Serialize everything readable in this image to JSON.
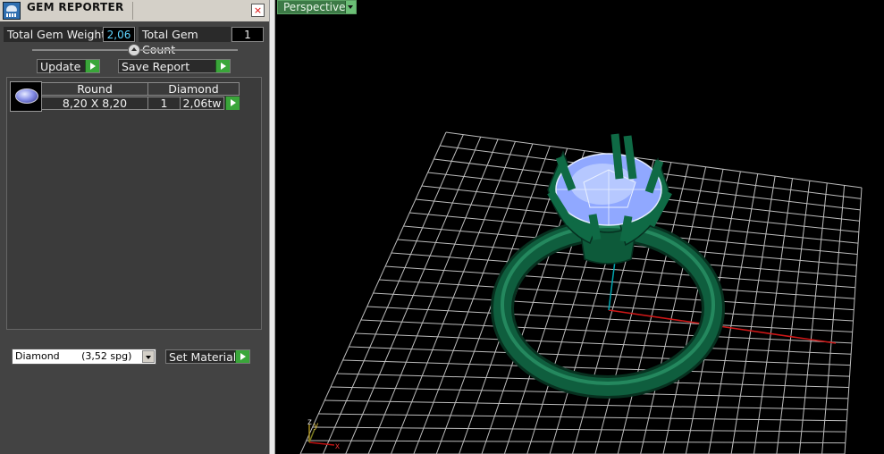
{
  "panel": {
    "title": "GEM REPORTER",
    "close_label": "×",
    "total_weight_label": "Total Gem Weight",
    "total_weight_value": "2,06",
    "total_count_label": "Total Gem Count",
    "total_count_value": "1",
    "update_label": "Update",
    "save_report_label": "Save Report",
    "table": {
      "headers": [
        "Round",
        "Diamond"
      ],
      "row": {
        "size": "8,20 X 8,20",
        "count": "1",
        "weight": "2,06tw"
      }
    },
    "material_select_value": "Diamond       (3,52 spg)",
    "set_material_label": "Set Material"
  },
  "viewport": {
    "view_label": "Perspective",
    "axis_labels": {
      "x": "x",
      "y": "y",
      "z": "z"
    }
  },
  "colors": {
    "panel_bg": "#434343",
    "accent_green": "#3aa63a",
    "value_text": "#5fd4ff",
    "ring_green": "#0e5a3c",
    "gem_blue": "#8fb0ff",
    "x_axis": "#d01818",
    "y_axis": "#00a6b0"
  },
  "icons": {
    "app": "gem-reporter-app-icon",
    "close": "close-icon",
    "go": "green-arrow-icon",
    "dropdown": "chevron-down-icon",
    "slider": "slider-thumb-icon"
  }
}
